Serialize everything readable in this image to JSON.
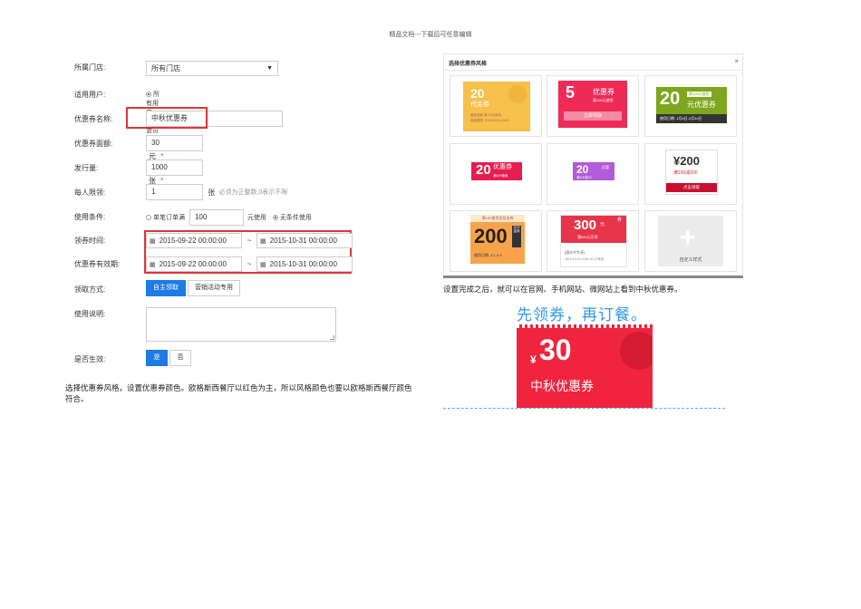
{
  "header_note": "精品文档---下载后可任意编辑",
  "form": {
    "store": {
      "label": "所属门店:",
      "value": "所有门店"
    },
    "user_scope": {
      "label": "适用用户:",
      "options": [
        "所有用户",
        "会员细则"
      ]
    },
    "coupon_name": {
      "label": "优惠券名称:",
      "value": "中秋优惠券"
    },
    "amount": {
      "label": "优惠券面额:",
      "value": "30",
      "unit": "元"
    },
    "issue_count": {
      "label": "发行量:",
      "value": "1000",
      "unit": "张"
    },
    "per_person": {
      "label": "每人限领:",
      "value": "1",
      "unit": "张",
      "hint": "必须为正整数,0表示不限"
    },
    "condition": {
      "label": "使用条件:",
      "option1": "单笔订单满",
      "value": "100",
      "after": "元使用",
      "option2": "无条件使用"
    },
    "claim_time": {
      "label": "领券时间:",
      "start": "2015-09-22 00:00:00",
      "sep": "~",
      "end": "2015-10-31 00:00:00"
    },
    "valid_time": {
      "label": "优惠券有效期:",
      "start": "2015-09-22 00:00:00",
      "sep": "~",
      "end": "2015-10-31 00:00:00"
    },
    "claim_method": {
      "label": "领取方式:",
      "options": [
        "自主领取",
        "营销活动专用"
      ]
    },
    "description": {
      "label": "使用说明:"
    },
    "active": {
      "label": "是否生效:",
      "options": [
        "是",
        "否"
      ]
    },
    "required_mark": "*"
  },
  "left_paragraph": "选择优惠券风格，设置优惠券颜色。欧格斯西餐厅以红色为主，所以风格颜色也要以欧格斯西餐厅颜色符合。",
  "panel": {
    "title": "选择优惠券风格",
    "close": "×",
    "t1": {
      "amount": "20",
      "label": "代金券",
      "line1": "最低金额 满 15元使用",
      "line2": "使用期限: 2015/03/04-04/01"
    },
    "t2": {
      "amount": "5",
      "title": "优惠券",
      "sub": "满100元使用",
      "btn": "立即领取"
    },
    "t3": {
      "amount": "20",
      "tag": "满100元使用",
      "title": "元优惠券",
      "date": "使用日期: 1月8日-3月10日"
    },
    "t4": {
      "amount": "20",
      "title": "优惠券",
      "sub": "满400使用"
    },
    "t5": {
      "amount": "20",
      "side": "优惠",
      "sub": "满100减20"
    },
    "t6": {
      "amount": "¥200",
      "sub": "满100减200",
      "btn": "点击领取"
    },
    "t7": {
      "header": "满100使用抵扣金券",
      "amount": "200",
      "side": "元代金券",
      "date": "使用日期: 3.1-9.9"
    },
    "t8": {
      "amount": "300",
      "unit": "元",
      "sub": "满600元可用",
      "foot1": "[国庆节专享]",
      "foot2": "2015.10.01-2015.10.10有效",
      "corner": "券"
    },
    "t9": {
      "label": "自定义样式"
    }
  },
  "right_paragraph": "设置完成之后，就可以在官网、手机网站、微网站上看到中秋优惠券。",
  "preview": {
    "headline": "先领券，再订餐。",
    "yen": "¥",
    "amount": "30",
    "name": "中秋优惠券"
  },
  "colors": {
    "primary_blue": "#1d7ae6",
    "highlight_red": "#e0353b",
    "coupon_red": "#f0243e",
    "headline_blue": "#2f9ae8"
  }
}
